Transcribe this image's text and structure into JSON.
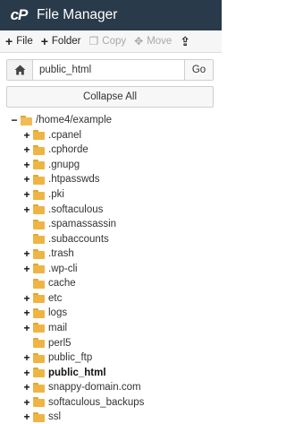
{
  "header": {
    "logo_text": "cP",
    "title": "File Manager"
  },
  "toolbar": [
    {
      "icon": "plus-icon",
      "label": "File",
      "enabled": true
    },
    {
      "icon": "plus-icon",
      "label": "Folder",
      "enabled": true
    },
    {
      "icon": "copy-icon",
      "label": "Copy",
      "enabled": false
    },
    {
      "icon": "move-icon",
      "label": "Move",
      "enabled": false
    }
  ],
  "pathbar": {
    "value": "public_html",
    "go_label": "Go"
  },
  "collapse_label": "Collapse All",
  "tree": {
    "root": {
      "label": "/home4/example",
      "expanded": true
    },
    "items": [
      {
        "label": ".cpanel",
        "expandable": true
      },
      {
        "label": ".cphorde",
        "expandable": true
      },
      {
        "label": ".gnupg",
        "expandable": true
      },
      {
        "label": ".htpasswds",
        "expandable": true
      },
      {
        "label": ".pki",
        "expandable": true
      },
      {
        "label": ".softaculous",
        "expandable": true
      },
      {
        "label": ".spamassassin",
        "expandable": false
      },
      {
        "label": ".subaccounts",
        "expandable": false
      },
      {
        "label": ".trash",
        "expandable": true
      },
      {
        "label": ".wp-cli",
        "expandable": true
      },
      {
        "label": "cache",
        "expandable": false
      },
      {
        "label": "etc",
        "expandable": true
      },
      {
        "label": "logs",
        "expandable": true
      },
      {
        "label": "mail",
        "expandable": true
      },
      {
        "label": "perl5",
        "expandable": false
      },
      {
        "label": "public_ftp",
        "expandable": true
      },
      {
        "label": "public_html",
        "expandable": true,
        "selected": true
      },
      {
        "label": "snappy-domain.com",
        "expandable": true
      },
      {
        "label": "softaculous_backups",
        "expandable": true
      },
      {
        "label": "ssl",
        "expandable": true
      }
    ]
  }
}
